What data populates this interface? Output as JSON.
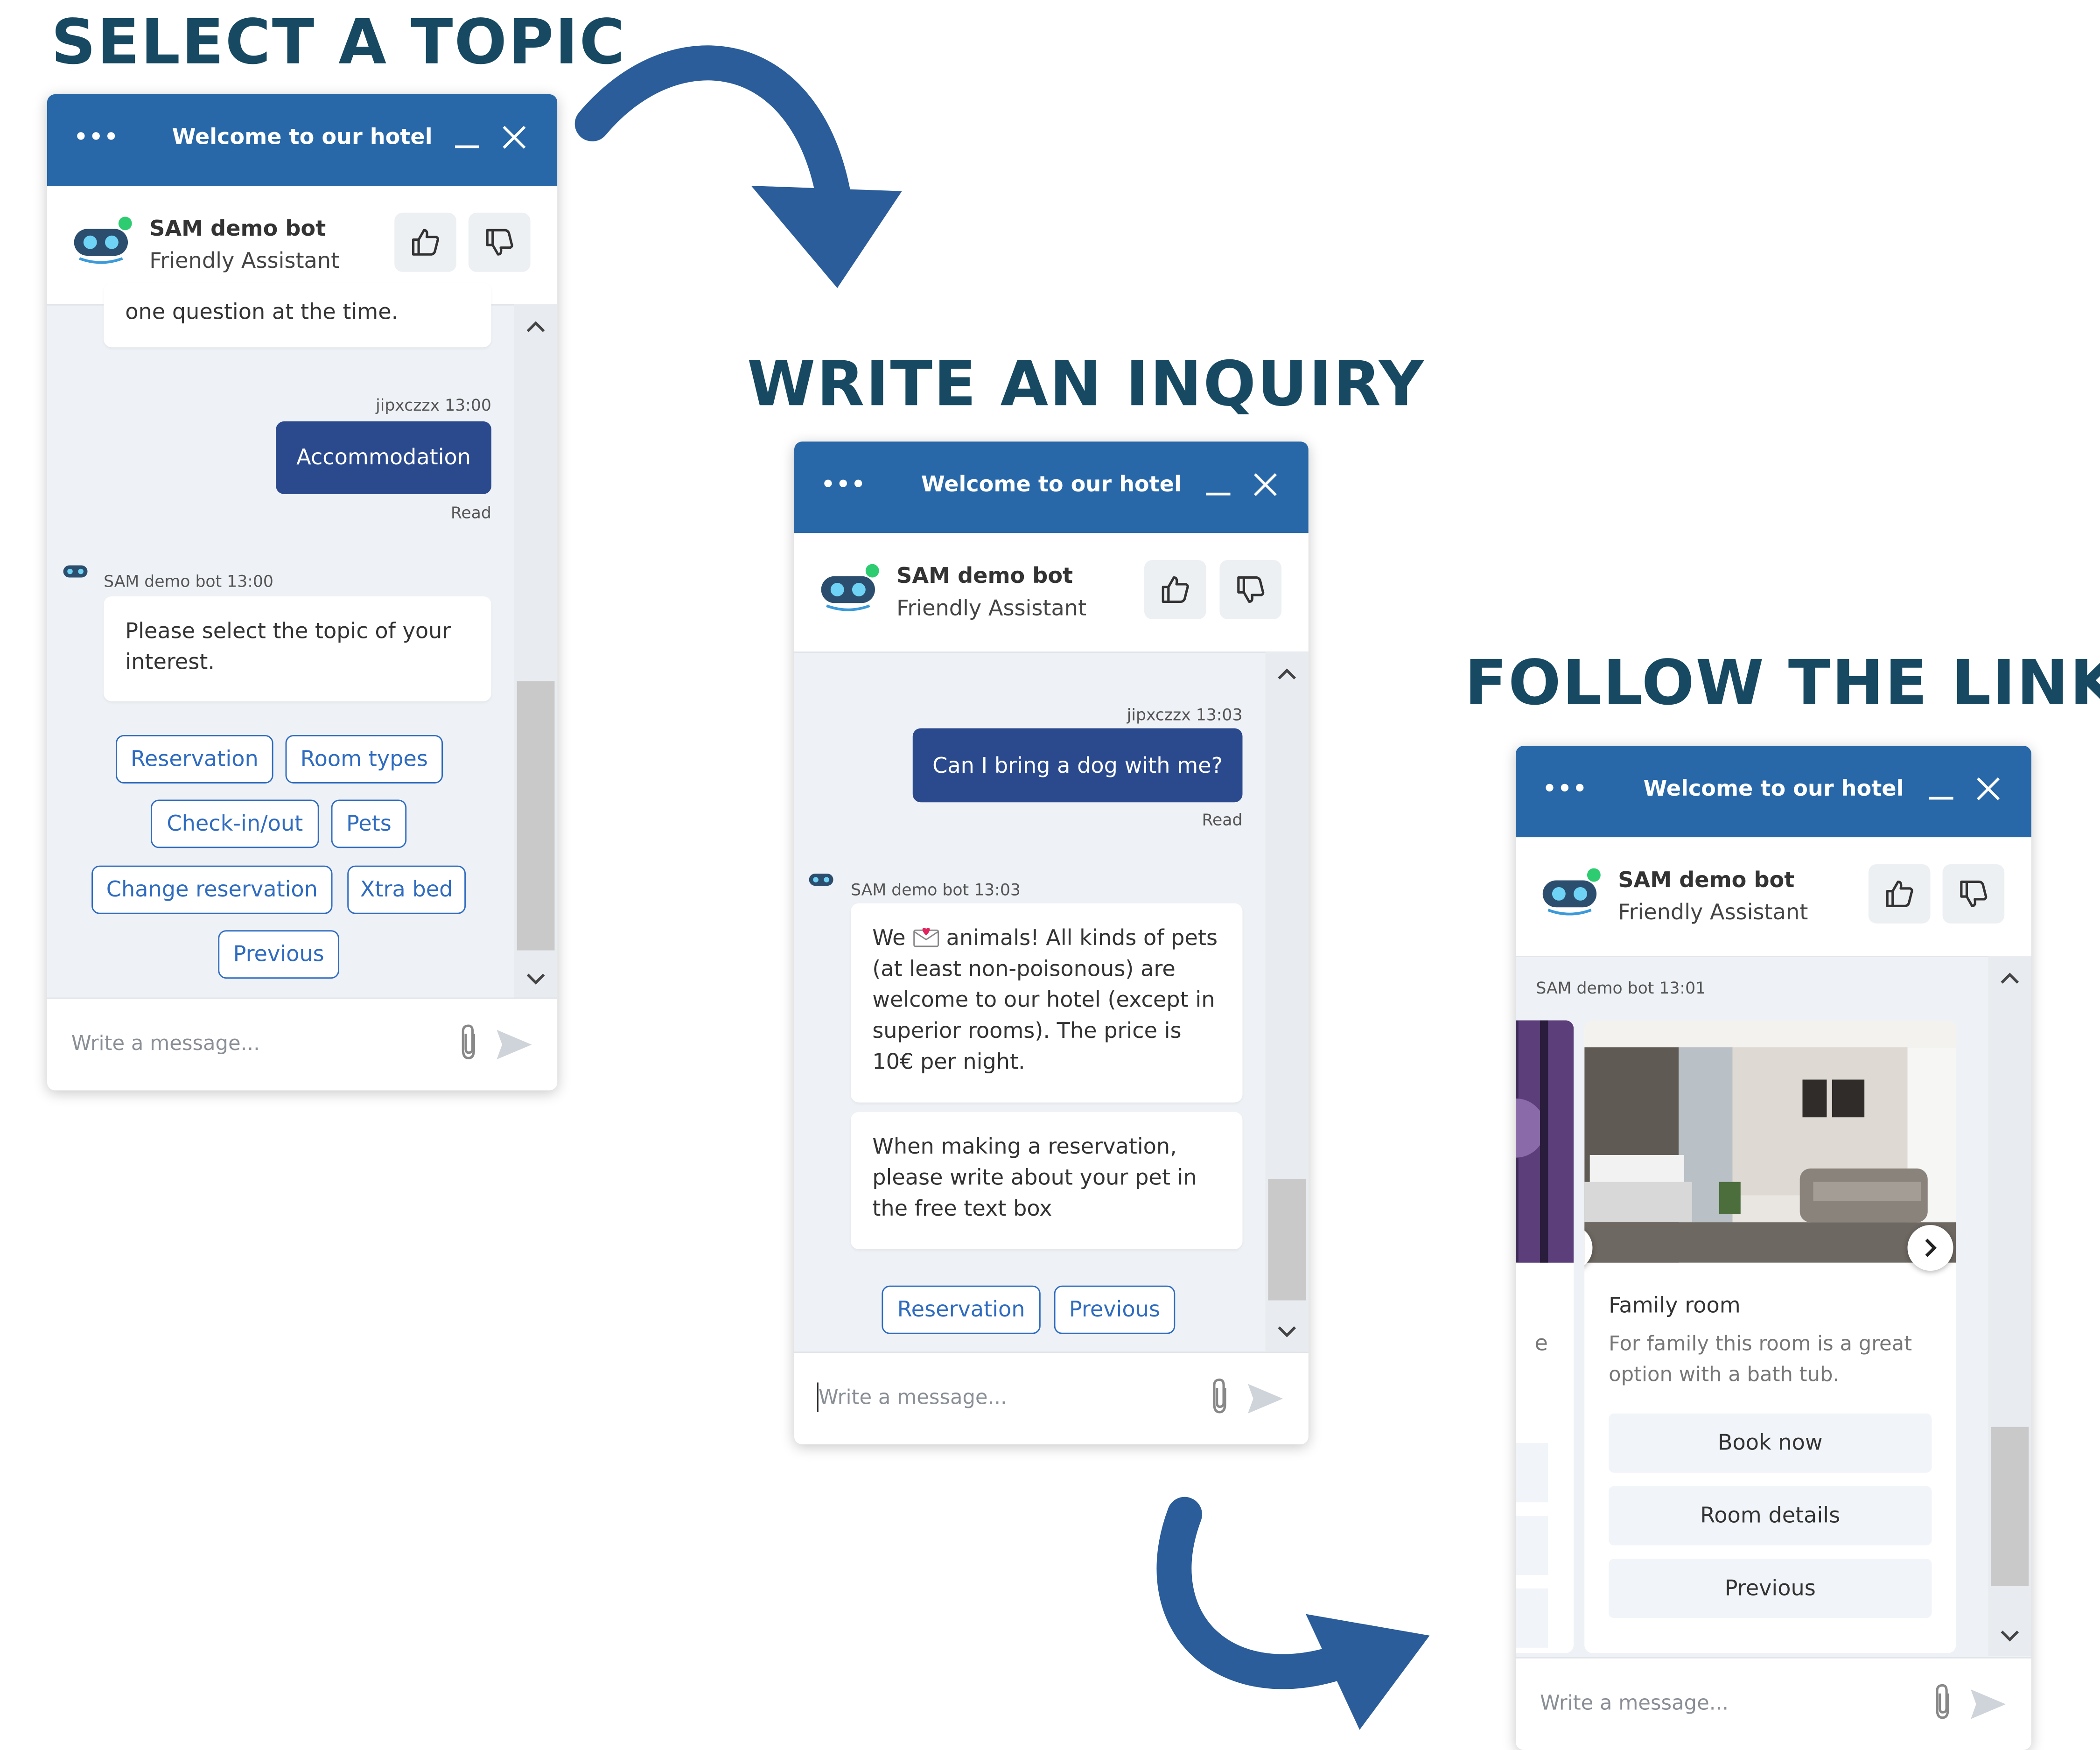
{
  "headings": {
    "step1": "SELECT A TOPIC",
    "step2": "WRITE AN INQUIRY",
    "step3": "FOLLOW THE LINKS"
  },
  "widget": {
    "menu_label": "•••",
    "title": "Welcome to our hotel",
    "bot_name": "SAM demo bot",
    "bot_subtitle": "Friendly Assistant",
    "input_placeholder": "Write a message...",
    "accent_color": "#2868a8",
    "user_bubble_color": "#2b4a8e",
    "link_color": "#2f6cc0",
    "status_dot_color": "#2ecc71"
  },
  "panel1": {
    "partial_text": "one question at the time.",
    "user_meta": "jipxczzx 13:00",
    "user_message": "Accommodation",
    "read_label": "Read",
    "bot_meta": "SAM demo bot 13:00",
    "bot_message": "Please select the topic of your interest.",
    "quick_replies": [
      "Reservation",
      "Room types",
      "Check-in/out",
      "Pets",
      "Change reservation",
      "Xtra bed",
      "Previous"
    ]
  },
  "panel2": {
    "user_meta": "jipxczzx 13:03",
    "user_message": "Can I bring a dog with me?",
    "read_label": "Read",
    "bot_meta": "SAM demo bot 13:03",
    "bot_message_1_prefix": "We",
    "bot_message_1_suffix": "animals! All kinds of pets (at least non-poisonous) are welcome to our hotel (except in superior rooms). The price is 10€ per night.",
    "bot_message_2": "When making a reservation, please write about your pet in the free text box",
    "quick_replies": [
      "Reservation",
      "Previous"
    ]
  },
  "panel3": {
    "bot_meta": "SAM demo bot 13:01",
    "card_title": "Family room",
    "card_description": "For family this room is a great option with a bath tub.",
    "prev_card_fragment": "e",
    "card_buttons": [
      "Book now",
      "Room details",
      "Previous"
    ]
  }
}
